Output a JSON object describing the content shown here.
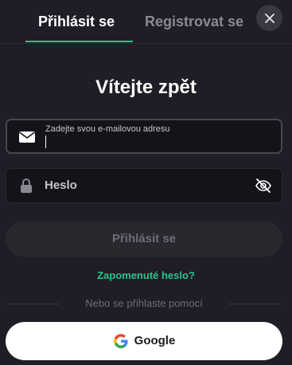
{
  "tabs": {
    "login": "Přihlásit se",
    "register": "Registrovat se"
  },
  "title": "Vítejte zpět",
  "email": {
    "placeholder": "Zadejte svou e-mailovou adresu",
    "value": ""
  },
  "password": {
    "placeholder": "Heslo",
    "value": ""
  },
  "submit_label": "Přihlásit se",
  "forgot_label": "Zapomenuté heslo?",
  "divider_label": "Nebo se přihlaste pomocí",
  "google_label": "Google",
  "colors": {
    "accent": "#29c48a",
    "background": "#201d26",
    "field_background": "#15131a"
  },
  "icons": {
    "close": "close-icon",
    "email": "envelope-icon",
    "password": "lock-icon",
    "visibility": "eye-off-icon",
    "google": "google-icon"
  }
}
